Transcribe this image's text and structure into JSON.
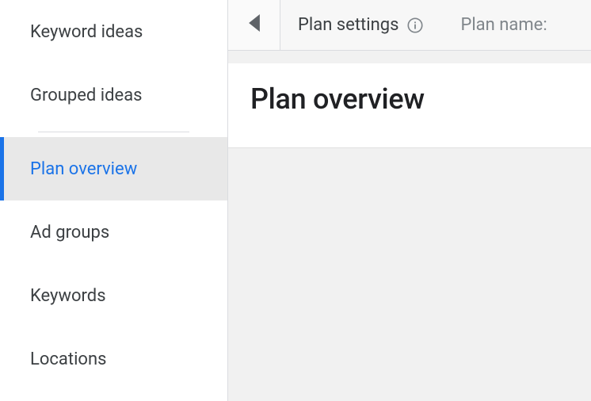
{
  "sidebar": {
    "items": [
      {
        "label": "Keyword ideas",
        "active": false
      },
      {
        "label": "Grouped ideas",
        "active": false
      },
      {
        "label": "Plan overview",
        "active": true
      },
      {
        "label": "Ad groups",
        "active": false
      },
      {
        "label": "Keywords",
        "active": false
      },
      {
        "label": "Locations",
        "active": false
      }
    ]
  },
  "topbar": {
    "settings_label": "Plan settings",
    "plan_name_label": "Plan name:"
  },
  "main": {
    "title": "Plan overview"
  }
}
